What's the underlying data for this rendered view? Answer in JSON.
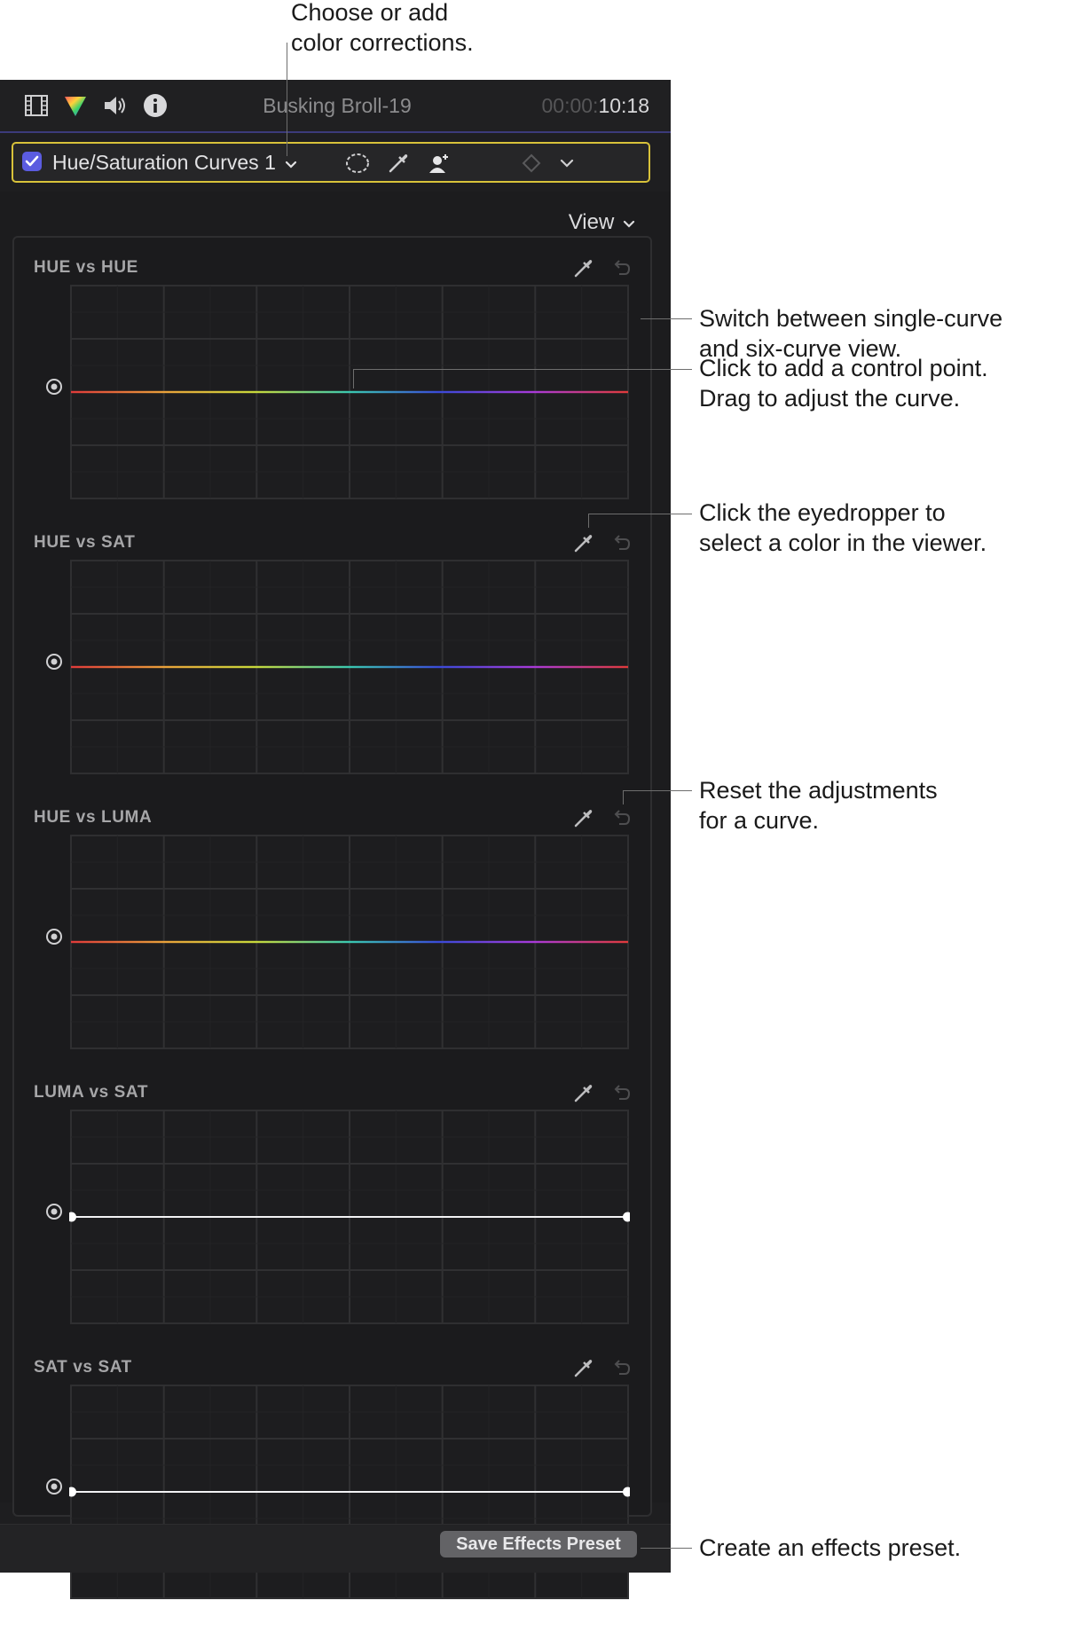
{
  "callouts": {
    "color_corrections": "Choose or add\ncolor corrections.",
    "view_switch": "Switch between single-curve\nand six-curve view.",
    "control_point": "Click to add a control point.\nDrag to adjust the curve.",
    "eyedropper": "Click the eyedropper to\nselect a color in the viewer.",
    "reset": "Reset the adjustments\nfor a curve.",
    "preset": "Create an effects preset."
  },
  "header": {
    "icons": [
      "film-icon",
      "color-icon",
      "audio-icon",
      "info-icon"
    ],
    "clip_name": "Busking Broll-19",
    "timecode_dim": "00:00:",
    "timecode_bright": "10:18"
  },
  "effect": {
    "enabled": true,
    "name": "Hue/Saturation Curves 1",
    "accent_color": "#d8c23a",
    "checkbox_color": "#5b5ce0"
  },
  "view_button": "View",
  "curves": [
    {
      "label": "HUE vs HUE",
      "curve": "rainbow"
    },
    {
      "label": "HUE vs SAT",
      "curve": "rainbow"
    },
    {
      "label": "HUE vs LUMA",
      "curve": "rainbow"
    },
    {
      "label": "LUMA vs SAT",
      "curve": "white"
    },
    {
      "label": "SAT vs SAT",
      "curve": "white"
    }
  ],
  "footer": {
    "save_button": "Save Effects Preset"
  }
}
